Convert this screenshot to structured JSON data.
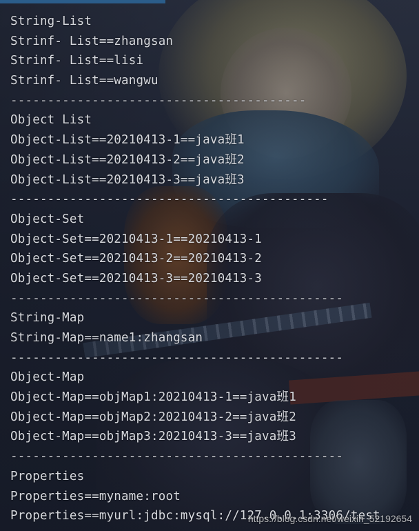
{
  "console": {
    "lines": [
      "String-List",
      "Strinf- List==zhangsan",
      "Strinf- List==lisi",
      "Strinf- List==wangwu",
      "----------------------------------------",
      "Object List",
      "Object-List==20210413-1==java班1",
      "Object-List==20210413-2==java班2",
      "Object-List==20210413-3==java班3",
      "-------------------------------------------",
      "Object-Set",
      "Object-Set==20210413-1==20210413-1",
      "Object-Set==20210413-2==20210413-2",
      "Object-Set==20210413-3==20210413-3",
      "---------------------------------------------",
      "String-Map",
      "String-Map==name1:zhangsan",
      "---------------------------------------------",
      "Object-Map",
      "Object-Map==objMap1:20210413-1==java班1",
      "Object-Map==objMap2:20210413-2==java班2",
      "Object-Map==objMap3:20210413-3==java班3",
      "---------------------------------------------",
      "Properties",
      "Properties==myname:root",
      "Properties==myurl:jdbc:mysql://127.0.0.1:3306/test"
    ]
  },
  "watermark": "https://blog.csdn.net/weixin_52192654"
}
